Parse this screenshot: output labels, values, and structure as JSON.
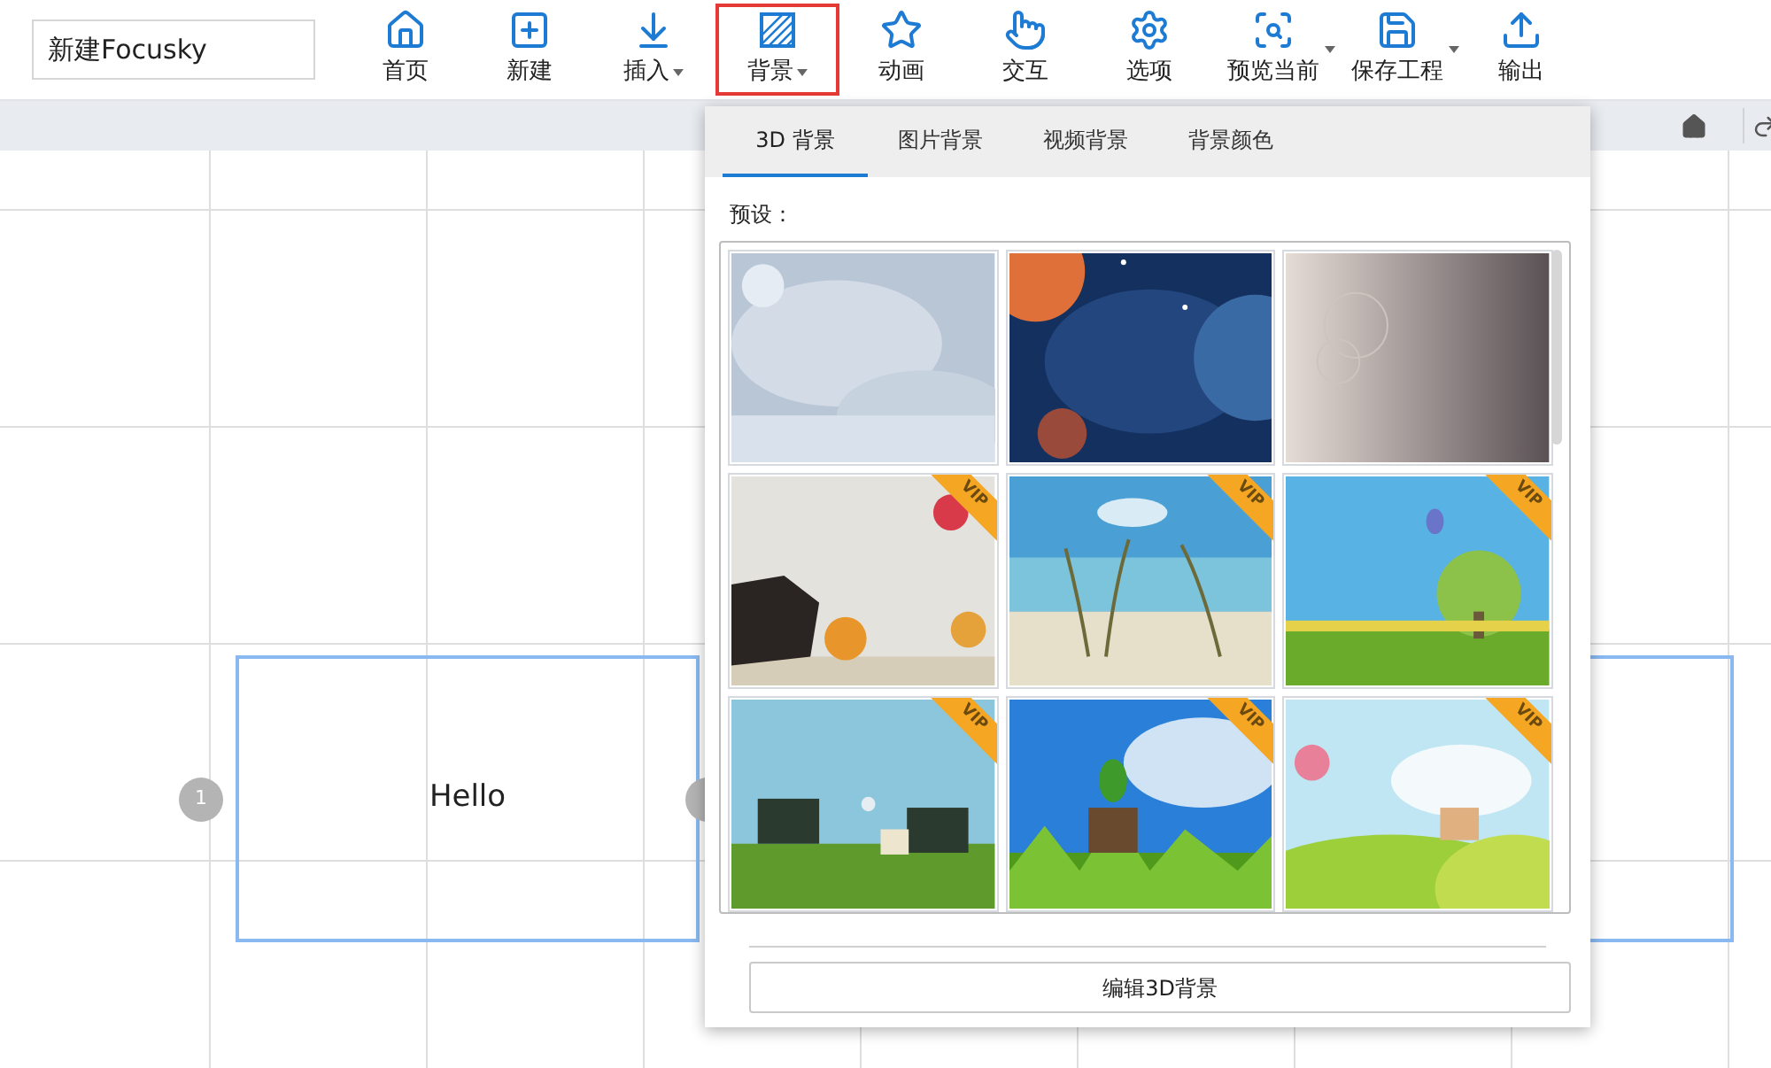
{
  "project_name": "新建Focusky",
  "toolbar": [
    {
      "label": "首页",
      "kind": "plain",
      "selected": false
    },
    {
      "label": "新建",
      "kind": "plain",
      "selected": false
    },
    {
      "label": "插入",
      "kind": "caret",
      "selected": false
    },
    {
      "label": "背景",
      "kind": "caret",
      "selected": true
    },
    {
      "label": "动画",
      "kind": "plain",
      "selected": false
    },
    {
      "label": "交互",
      "kind": "plain",
      "selected": false
    },
    {
      "label": "选项",
      "kind": "plain",
      "selected": false
    },
    {
      "label": "预览当前",
      "kind": "split",
      "selected": false
    },
    {
      "label": "保存工程",
      "kind": "split",
      "selected": false
    },
    {
      "label": "输出",
      "kind": "plain",
      "selected": false
    }
  ],
  "slides": [
    {
      "kind": "frame",
      "number": "1",
      "text": "Hello"
    },
    {
      "kind": "covered"
    }
  ],
  "background_panel": {
    "tabs": [
      {
        "label": "3D 背景",
        "selected": true
      },
      {
        "label": "图片背景",
        "selected": false
      },
      {
        "label": "视频背景",
        "selected": false
      },
      {
        "label": "背景颜色",
        "selected": false
      }
    ],
    "section_label": "预设：",
    "thumbnails": [
      {
        "kind": "picture"
      },
      {
        "kind": "picture"
      },
      {
        "kind": "picture"
      },
      {
        "kind": "picture",
        "badge": "VIP"
      },
      {
        "kind": "picture",
        "badge": "VIP"
      },
      {
        "kind": "picture",
        "badge": "VIP"
      },
      {
        "kind": "picture",
        "badge": "VIP"
      },
      {
        "kind": "picture",
        "badge": "VIP"
      },
      {
        "kind": "picture",
        "badge": "VIP"
      }
    ],
    "edit_button": "编辑3D背景"
  }
}
